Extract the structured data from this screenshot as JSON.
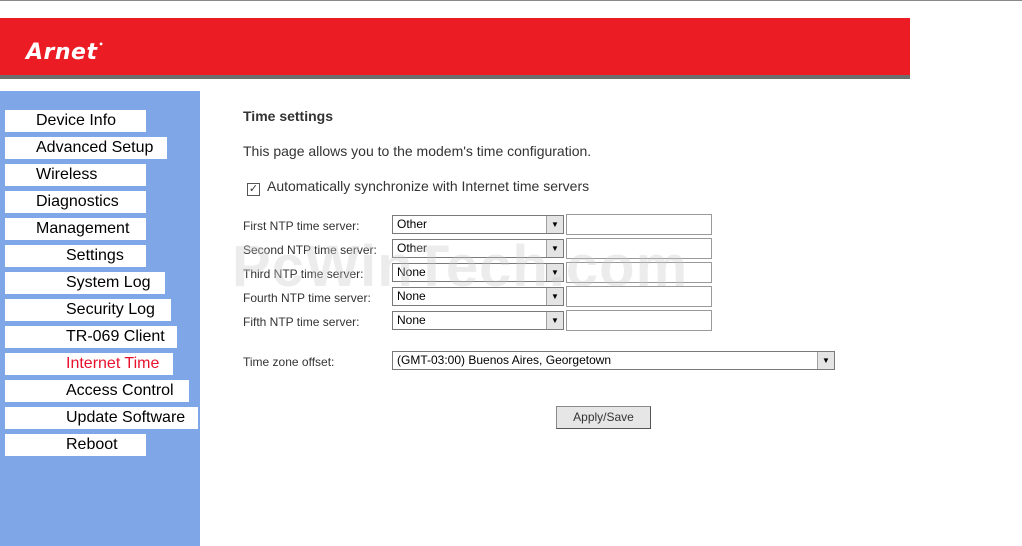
{
  "brand": {
    "logo": "Arnet",
    "trademark": "•"
  },
  "sidebar": {
    "items": [
      {
        "label": "Device Info"
      },
      {
        "label": "Advanced Setup"
      },
      {
        "label": "Wireless"
      },
      {
        "label": "Diagnostics"
      },
      {
        "label": "Management"
      },
      {
        "label": "Settings"
      },
      {
        "label": "System Log"
      },
      {
        "label": "Security Log"
      },
      {
        "label": "TR-069 Client"
      },
      {
        "label": "Internet Time"
      },
      {
        "label": "Access Control"
      },
      {
        "label": "Update Software"
      },
      {
        "label": "Reboot"
      }
    ],
    "active_color": "#e8112d"
  },
  "page": {
    "title": "Time settings",
    "description": "This page allows you to the modem's time configuration.",
    "auto_sync": {
      "checked": true,
      "check_mark": "✓",
      "label": "Automatically synchronize with Internet time servers"
    }
  },
  "ntp": [
    {
      "label": "First NTP time server:",
      "value": "Other",
      "custom": ""
    },
    {
      "label": "Second NTP time server:",
      "value": "Other",
      "custom": ""
    },
    {
      "label": "Third NTP time server:",
      "value": "None",
      "custom": ""
    },
    {
      "label": "Fourth NTP time server:",
      "value": "None",
      "custom": ""
    },
    {
      "label": "Fifth NTP time server:",
      "value": "None",
      "custom": ""
    }
  ],
  "timezone": {
    "label": "Time zone offset:",
    "value": "(GMT-03:00) Buenos Aires, Georgetown"
  },
  "apply_button": "Apply/Save",
  "watermark": "PcWinTech.com",
  "colors": {
    "header": "#ec1c24",
    "sidebar": "#7fa6e6"
  }
}
